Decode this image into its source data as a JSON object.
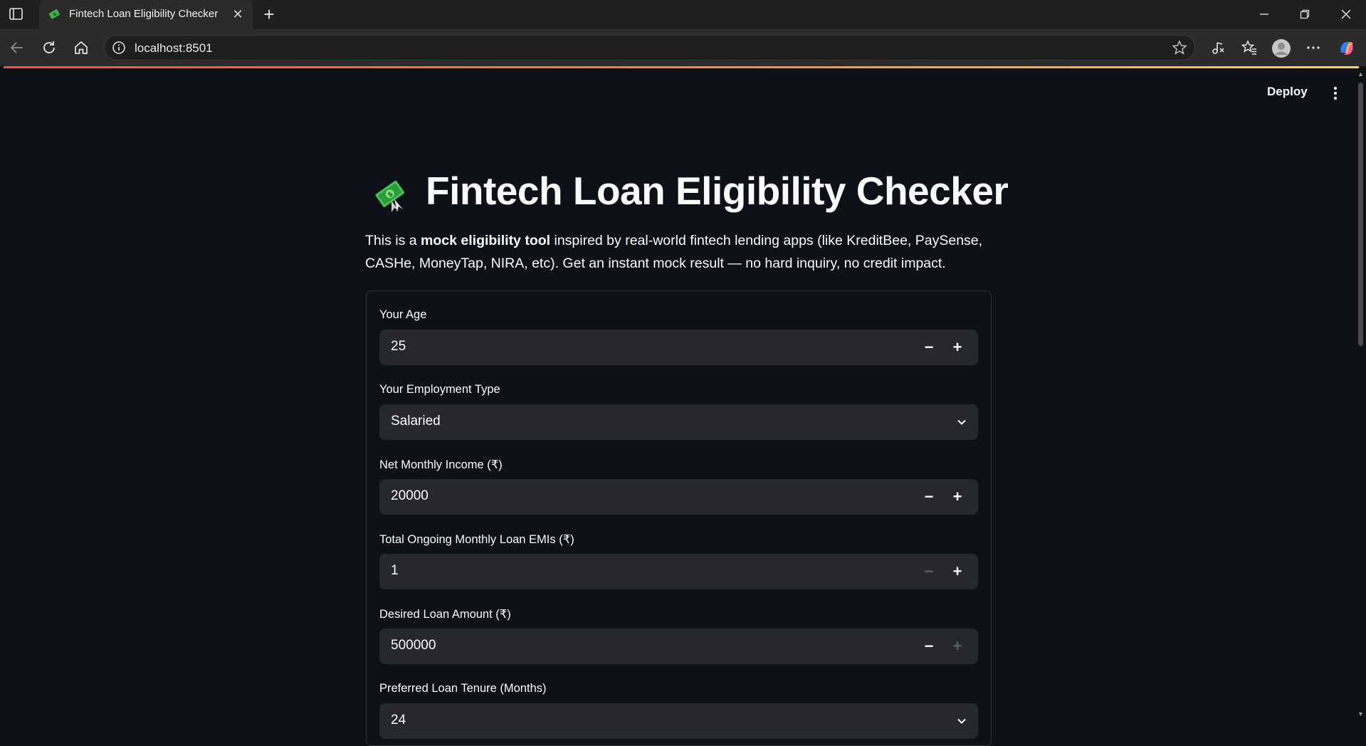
{
  "browser": {
    "tab_title": "Fintech Loan Eligibility Checker",
    "address": "localhost:8501"
  },
  "app": {
    "deploy_label": "Deploy",
    "title": "Fintech Loan Eligibility Checker",
    "title_emoji": "💸",
    "intro_before": "This is a ",
    "intro_bold": "mock eligibility tool",
    "intro_after": " inspired by real-world fintech lending apps (like KreditBee, PaySense, CASHe, MoneyTap, NIRA, etc). Get an instant mock result — no hard inquiry, no credit impact."
  },
  "form": {
    "age": {
      "label": "Your Age",
      "value": "25"
    },
    "employment": {
      "label": "Your Employment Type",
      "value": "Salaried"
    },
    "income": {
      "label": "Net Monthly Income (₹)",
      "value": "20000"
    },
    "emis": {
      "label": "Total Ongoing Monthly Loan EMIs (₹)",
      "value": "1"
    },
    "loan_amount": {
      "label": "Desired Loan Amount (₹)",
      "value": "500000"
    },
    "tenure": {
      "label": "Preferred Loan Tenure (Months)",
      "value": "24"
    },
    "minus": "−",
    "plus": "+"
  },
  "colors": {
    "background": "#0e1117",
    "input_bg": "#262730",
    "accent_red": "#ff4b4b"
  }
}
